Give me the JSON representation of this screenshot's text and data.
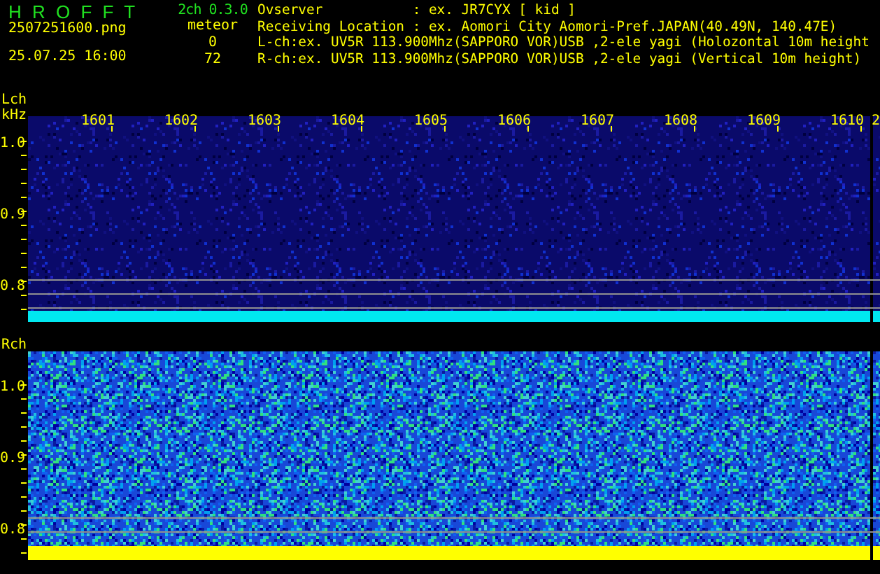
{
  "header": {
    "title": "H R O F F T",
    "version": "2ch 0.3.0",
    "filename": "2507251600.png",
    "datetime": "25.07.25 16:00",
    "meteor_label": "meteor",
    "l_count": "0",
    "r_count": "72"
  },
  "info": [
    {
      "label": "Ovserver           ",
      "value": ": ex. JR7CYX [ kid ]"
    },
    {
      "label": "Receiving Location ",
      "value": ": ex. Aomori City Aomori-Pref.JAPAN(40.49N, 140.47E)"
    },
    {
      "label": "L-ch:",
      "value": "ex. UV5R 113.900Mhz(SAPPORO VOR)USB ,2-ele yagi (Holozontal 10m height"
    },
    {
      "label": "R-ch:",
      "value": "ex. UV5R 113.900Mhz(SAPPORO VOR)USB ,2-ele yagi (Vertical 10m height)"
    }
  ],
  "time_labels": [
    "1601",
    "1602",
    "1603",
    "1604",
    "1605",
    "1606",
    "1607",
    "1608",
    "1609",
    "1610",
    "2"
  ],
  "channels": [
    {
      "label": "Lch",
      "unit": "kHz",
      "kind": "weak",
      "yticks": [
        "1.0",
        "0.9",
        "0.8"
      ]
    },
    {
      "label": "Rch",
      "kind": "strong",
      "yticks": [
        "1.0",
        "0.9",
        "0.8"
      ]
    }
  ]
}
